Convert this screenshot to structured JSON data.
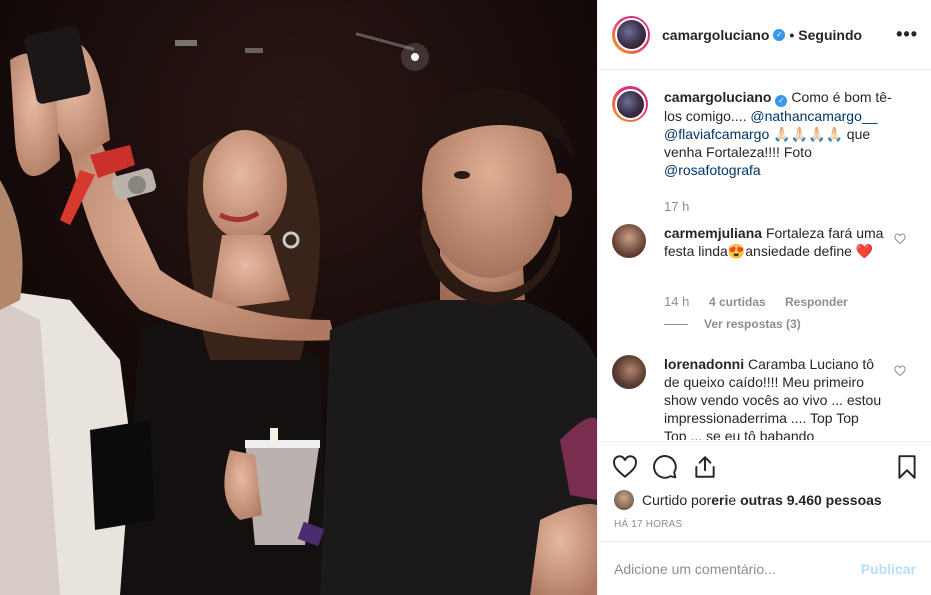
{
  "header": {
    "username": "camargoluciano",
    "separator": "•",
    "follow_status": "Seguindo",
    "more_icon": "more-horizontal-icon"
  },
  "caption": {
    "username": "camargoluciano",
    "text_1": "Como é bom tê-los comigo.... ",
    "mention_1": "@nathancamargo__",
    "mention_2": "@flaviafcamargo",
    "emoji": " 🙏🏻🙏🏻🙏🏻🙏🏻",
    "text_2": " que venha Fortaleza!!!! Foto ",
    "mention_3": "@rosafotografa",
    "time": "17 h"
  },
  "comments": [
    {
      "username": "carmemjuliana",
      "text": " Fortaleza fará uma festa linda😍ansiedade define ❤️",
      "time": "14 h",
      "likes": "4 curtidas",
      "reply": "Responder",
      "view_replies": "Ver respostas (3)"
    },
    {
      "username": "lorenadonni",
      "text": " Caramba Luciano tô de queixo caído!!!! Meu primeiro show vendo vocês ao vivo ... estou impressionaderrima .... Top Top Top ... se eu tô babando"
    }
  ],
  "likes": {
    "prefix": "Curtido por ",
    "user": "eri",
    "middle": " e ",
    "others": "outras 9.460 pessoas"
  },
  "timestamp": "HÁ 17 HORAS",
  "comment_box": {
    "placeholder": "Adicione um comentário...",
    "post_label": "Publicar"
  },
  "colors": {
    "verified": "#3897f0",
    "mention": "#003569",
    "muted": "#8e8e8e",
    "publish_disabled": "#b2dffc"
  }
}
